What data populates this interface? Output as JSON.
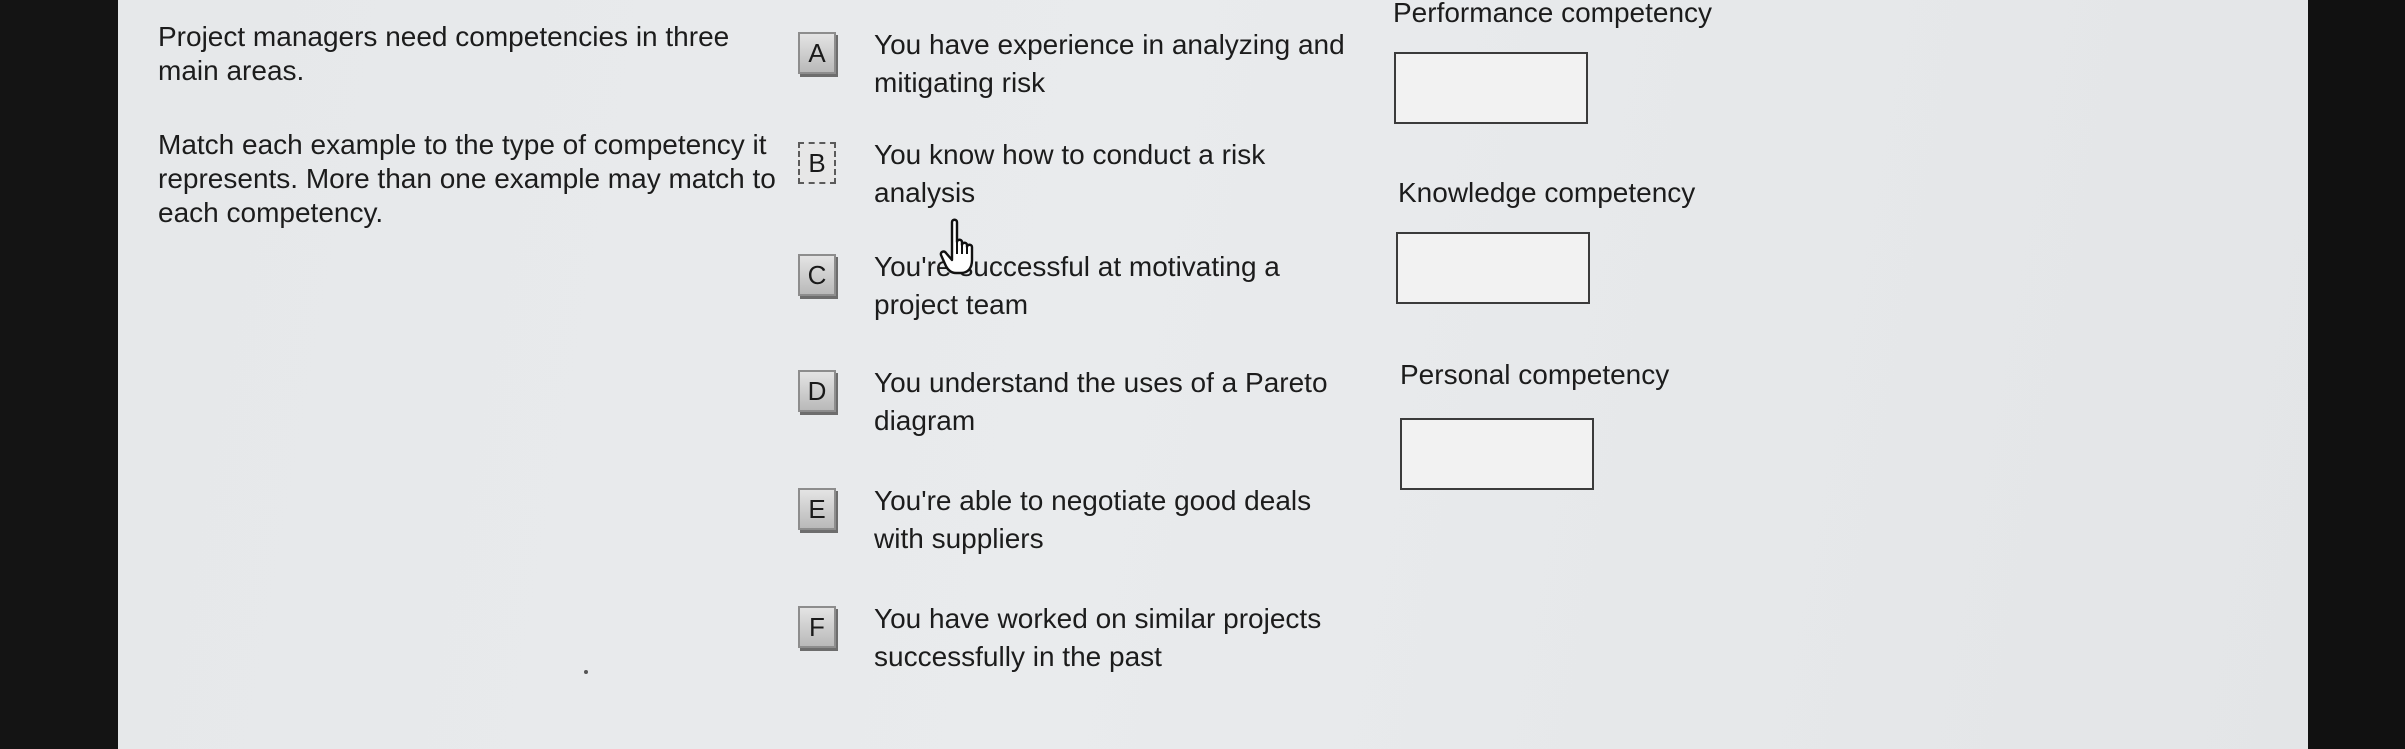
{
  "instructions": {
    "intro": "Project managers need competencies in three main areas.",
    "task": "Match each example to the type of competency it represents. More than one example may match to each competency."
  },
  "options": [
    {
      "letter": "A",
      "text": "You have experience in analyzing and mitigating risk"
    },
    {
      "letter": "B",
      "text": "You know how to conduct a risk analysis"
    },
    {
      "letter": "C",
      "text": "You're successful at motivating a project team"
    },
    {
      "letter": "D",
      "text": "You understand the uses of a Pareto diagram"
    },
    {
      "letter": "E",
      "text": "You're able to negotiate good deals with suppliers"
    },
    {
      "letter": "F",
      "text": "You have worked on similar projects successfully in the past"
    }
  ],
  "categories": [
    {
      "label": "Performance competency"
    },
    {
      "label": "Knowledge competency"
    },
    {
      "label": "Personal competency"
    }
  ],
  "pointer": {
    "icon": "hand-pointer-icon"
  }
}
